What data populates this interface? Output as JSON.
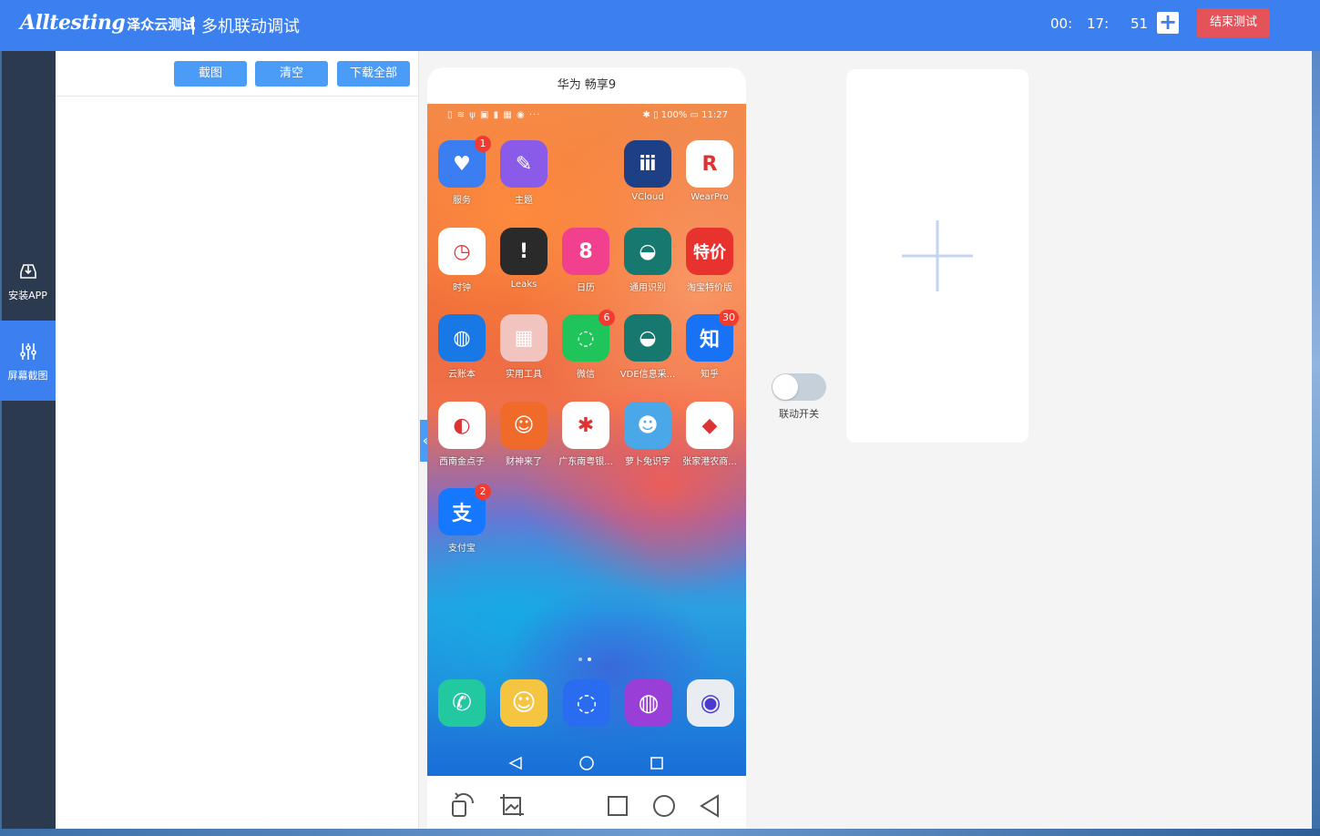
{
  "header": {
    "brand": "Alltesting",
    "brand_cn": "泽众云测试",
    "title": "多机联动调试",
    "timer": {
      "hours": "00:",
      "minutes": "17:",
      "seconds": "51"
    },
    "add_label": "+",
    "end_label": "结束测试"
  },
  "sidebar": {
    "items": [
      {
        "label": "安装APP",
        "icon": "install-icon"
      },
      {
        "label": "屏幕截图",
        "icon": "sliders-icon"
      }
    ]
  },
  "panel": {
    "buttons": {
      "screenshot": "截图",
      "clear": "清空",
      "download_all": "下载全部"
    },
    "collapse_glyph": "«"
  },
  "device": {
    "name": "华为 畅享9",
    "status_left": "▯ ≋ ψ ▣ ▮ ▦ ◉ ···",
    "status_right": "✱ ▯ 100% ▭ 11:27",
    "apps": [
      {
        "label": "服务",
        "badge": "1",
        "color": "#3a7ef2",
        "glyph": "♥"
      },
      {
        "label": "主题",
        "badge": "",
        "color": "#8a5be8",
        "glyph": "✎"
      },
      {
        "label": "VCloud",
        "badge": "",
        "color": "#1c3f86",
        "glyph": "ⅲ"
      },
      {
        "label": "WearPro",
        "badge": "",
        "color": "#ffffff",
        "glyph": "R"
      },
      {
        "label": "时钟",
        "badge": "",
        "color": "#ffffff",
        "glyph": "◷"
      },
      {
        "label": "Leaks",
        "badge": "",
        "color": "#2a2a2a",
        "glyph": "!"
      },
      {
        "label": "日历",
        "badge": "",
        "color": "#f0408e",
        "glyph": "8"
      },
      {
        "label": "通用识别",
        "badge": "",
        "color": "#16786e",
        "glyph": "◒"
      },
      {
        "label": "淘宝特价版",
        "badge": "",
        "color": "#e8322e",
        "glyph": "特价"
      },
      {
        "label": "云账本",
        "badge": "",
        "color": "#1878e6",
        "glyph": "◍"
      },
      {
        "label": "实用工具",
        "badge": "",
        "color": "#f2c4c0",
        "glyph": "▦"
      },
      {
        "label": "微信",
        "badge": "6",
        "color": "#1fc45a",
        "glyph": "◌"
      },
      {
        "label": "VDE信息采...",
        "badge": "",
        "color": "#16786e",
        "glyph": "◒"
      },
      {
        "label": "知乎",
        "badge": "30",
        "color": "#1772f6",
        "glyph": "知"
      },
      {
        "label": "西南金点子",
        "badge": "",
        "color": "#ffffff",
        "glyph": "◐"
      },
      {
        "label": "财神来了",
        "badge": "",
        "color": "#f06a2a",
        "glyph": "☺"
      },
      {
        "label": "广东南粤银...",
        "badge": "",
        "color": "#ffffff",
        "glyph": "✱"
      },
      {
        "label": "萝卜兔识字",
        "badge": "",
        "color": "#4aa8e8",
        "glyph": "☻"
      },
      {
        "label": "张家港农商...",
        "badge": "",
        "color": "#ffffff",
        "glyph": "◆"
      },
      {
        "label": "支付宝",
        "badge": "2",
        "color": "#1677ff",
        "glyph": "支"
      }
    ],
    "dock": [
      {
        "name": "phone",
        "color": "#21c8a0",
        "glyph": "✆"
      },
      {
        "name": "contacts",
        "color": "#f5c542",
        "glyph": "☺"
      },
      {
        "name": "messages",
        "color": "#2a6cf0",
        "glyph": "◌"
      },
      {
        "name": "browser",
        "color": "#9a3ed8",
        "glyph": "◍"
      },
      {
        "name": "camera",
        "color": "#e9edf2",
        "glyph": "◉"
      }
    ]
  },
  "toggle": {
    "label": "联动开关",
    "on": false
  },
  "colors": {
    "primary": "#3c80f0",
    "danger": "#e4535a",
    "sidebar": "#2c3a4f",
    "button": "#4a9cf6"
  }
}
